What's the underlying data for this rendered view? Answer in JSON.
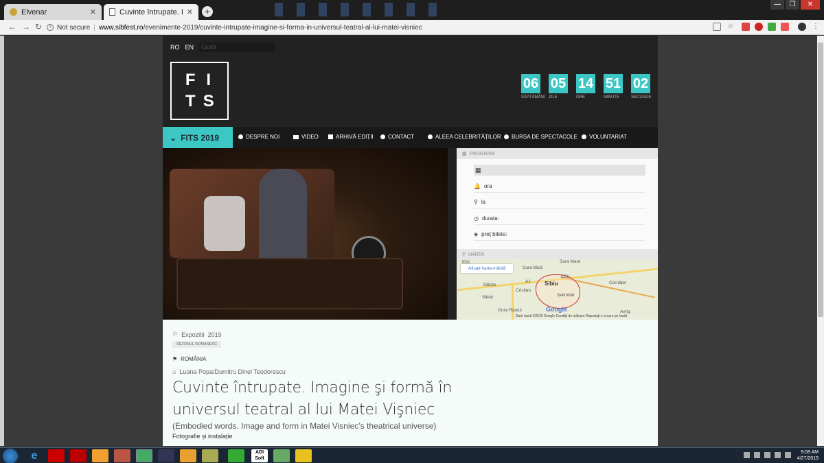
{
  "browser": {
    "tabs": [
      {
        "title": "Elvenar",
        "active": false
      },
      {
        "title": "Cuvinte întrupate. Imagine",
        "active": true
      }
    ],
    "security_label": "Not secure",
    "url_host": "www.sibfest.ro",
    "url_path": "/evenimente-2019/cuvinte-intrupate-imagine-si-forma-in-universul-teatral-al-lui-matei-visniec"
  },
  "site": {
    "lang": [
      "RO",
      "EN"
    ],
    "search_placeholder": "Caută",
    "logo_letters": [
      "F",
      "I",
      "T",
      "S"
    ],
    "countdown": [
      {
        "value": "06",
        "label": "SĂPTĂMÂNI"
      },
      {
        "value": "05",
        "label": "ZILE"
      },
      {
        "value": "14",
        "label": "ORE"
      },
      {
        "value": "51",
        "label": "MINUTE"
      },
      {
        "value": "02",
        "label": "SECUNDE"
      }
    ],
    "menu": {
      "active": "FITS 2019",
      "items": [
        "DESPRE NOI",
        "VIDEO",
        "ARHIVĂ EDIȚII",
        "CONTACT",
        "ALEEA CELEBRITĂȚILOR",
        "BURSA DE SPECTACOLE",
        "VOLUNTARIAT"
      ]
    },
    "program": {
      "heading": "PROGRAM",
      "ora": "ora",
      "la": "la",
      "durata": "durata:",
      "pret": "preț bilete:"
    },
    "harta": {
      "heading": "HARTA",
      "button": "Afișați harta mărită",
      "places": [
        "Șura Mare",
        "Șura Mică",
        "Sibiu",
        "Săliște",
        "Cristian",
        "Cornățel",
        "Sibiel",
        "Șelimbăr",
        "Gura Râului",
        "Avrig"
      ],
      "footer": "Date hartă ©2019 Google   Condiții de utilizare   Raportați o eroare pe hartă",
      "brand": "Google",
      "road_labels": [
        "E81",
        "E81",
        "A1"
      ]
    },
    "article": {
      "category": "Expozitii",
      "year": "2019",
      "tag": "SEZONUL ROMANESC",
      "country": "ROMÂNIA",
      "authors": "Luana Popa/Dumitru Dinel Teodorescu",
      "title": "Cuvinte întrupate. Imagine şi formă în universul teatral al lui Matei Vişniec",
      "subtitle": "(Embodied words. Image and form in Matei Visniec’s theatrical universe)",
      "type": "Fotografie și instalație"
    }
  },
  "taskbar": {
    "apps": [
      "ADI Soft"
    ],
    "time": "9:08 AM",
    "date": "4/27/2019"
  }
}
